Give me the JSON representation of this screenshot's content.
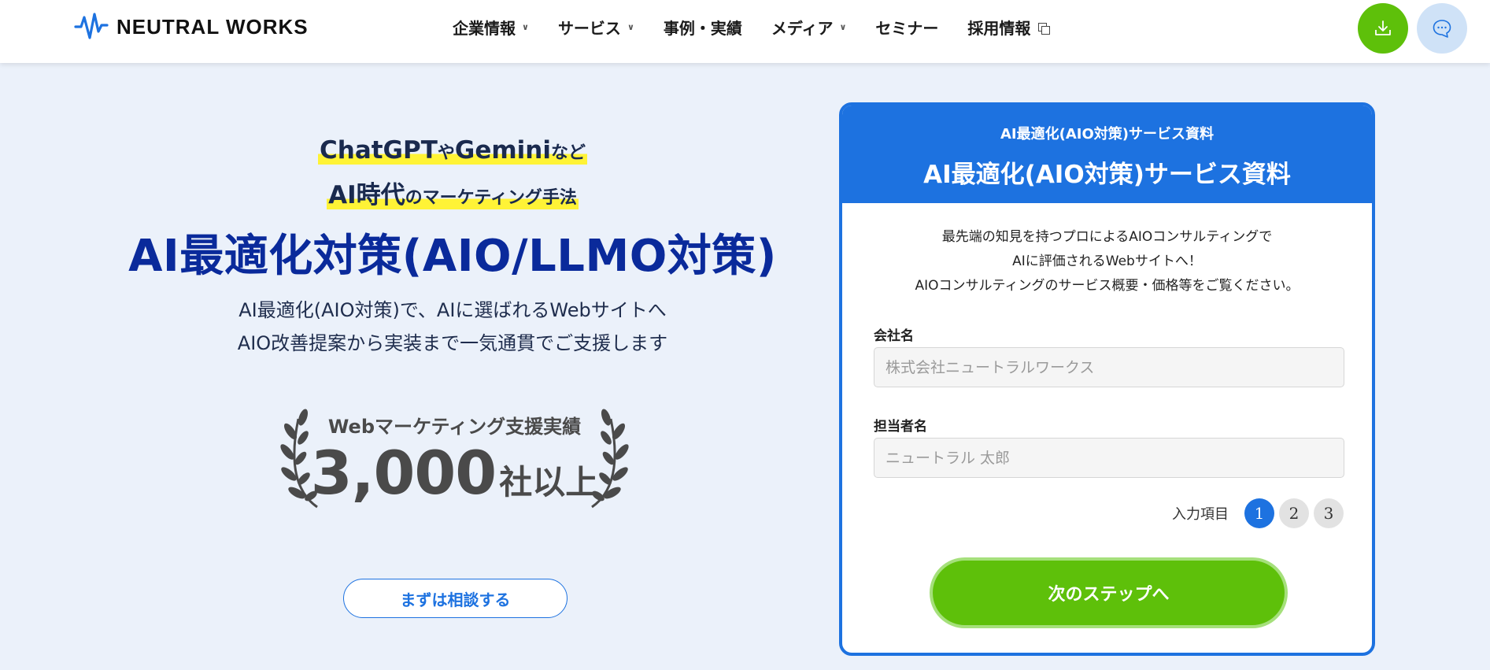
{
  "brand": {
    "name": "NEUTRAL WORKS"
  },
  "nav": {
    "items": [
      {
        "label": "企業情報",
        "has_dropdown": true
      },
      {
        "label": "サービス",
        "has_dropdown": true
      },
      {
        "label": "事例・実績",
        "has_dropdown": false
      },
      {
        "label": "メディア",
        "has_dropdown": true
      },
      {
        "label": "セミナー",
        "has_dropdown": false
      },
      {
        "label": "採用情報",
        "external": true
      }
    ]
  },
  "header_actions": {
    "download_icon": "download-icon",
    "chat_icon": "chat-bubble-icon"
  },
  "hero": {
    "lead1_a": "ChatGPT",
    "lead1_b": "や",
    "lead1_c": "Gemini",
    "lead1_d": "など",
    "lead2_a": "AI時代",
    "lead2_b": "のマーケティング手法",
    "title": "AI最適化対策(AIO/LLMO対策)",
    "subtitle_line1": "AI最適化(AIO対策)で、AIに選ばれるWebサイトへ",
    "subtitle_line2": "AIO改善提案から実装まで一気通貫でご支援します",
    "award_label": "Webマーケティング支援実績",
    "award_number": "3,000",
    "award_unit": "社以上",
    "cta_label": "まずは相談する"
  },
  "form": {
    "kicker": "AI最適化(AIO対策)サービス資料",
    "title": "AI最適化(AIO対策)サービス資料",
    "intro_line1": "最先端の知見を持つプロによるAIOコンサルティングで",
    "intro_line2": "AIに評価されるWebサイトへ！",
    "intro_line3": "AIOコンサルティングのサービス概要・価格等をご覧ください。",
    "company_label": "会社名",
    "company_placeholder": "株式会社ニュートラルワークス",
    "company_value": "",
    "person_label": "担当者名",
    "person_placeholder": "ニュートラル 太郎",
    "person_value": "",
    "steps_label": "入力項目",
    "steps": [
      "1",
      "2",
      "3"
    ],
    "current_step": 1,
    "next_label": "次のステップへ"
  },
  "colors": {
    "accent_blue": "#1d72e0",
    "cta_green": "#5ec00a",
    "title_navy": "#0a2a9b",
    "highlight_yellow": "#fff336",
    "page_bg": "#ebf1fa"
  }
}
